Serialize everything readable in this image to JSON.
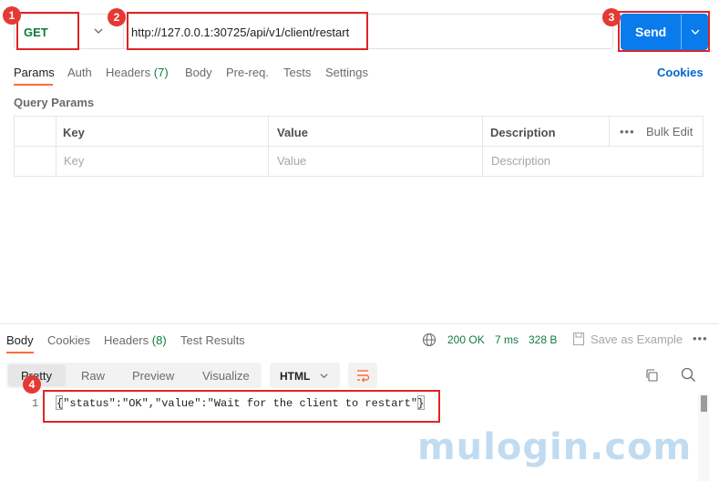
{
  "request": {
    "method": "GET",
    "url": "http://127.0.0.1:30725/api/v1/client/restart",
    "send_label": "Send"
  },
  "request_tabs": [
    {
      "label": "Params"
    },
    {
      "label": "Auth"
    },
    {
      "label": "Headers",
      "count": "(7)"
    },
    {
      "label": "Body"
    },
    {
      "label": "Pre-req."
    },
    {
      "label": "Tests"
    },
    {
      "label": "Settings"
    }
  ],
  "cookies_label": "Cookies",
  "query_params": {
    "title": "Query Params",
    "columns": [
      "Key",
      "Value",
      "Description"
    ],
    "bulk_edit": "Bulk Edit",
    "placeholders": [
      "Key",
      "Value",
      "Description"
    ]
  },
  "response": {
    "tabs": [
      {
        "label": "Body"
      },
      {
        "label": "Cookies"
      },
      {
        "label": "Headers",
        "count": "(8)"
      },
      {
        "label": "Test Results"
      }
    ],
    "status": "200 OK",
    "time": "7 ms",
    "size": "328 B",
    "save_example": "Save as Example",
    "views": [
      "Pretty",
      "Raw",
      "Preview",
      "Visualize"
    ],
    "format": "HTML",
    "line_number": "1",
    "body": "{\"status\":\"OK\",\"value\":\"Wait for the client to restart\"}"
  },
  "callouts": [
    "1",
    "2",
    "3",
    "4"
  ],
  "watermark": "mulogin.com",
  "colors": {
    "accent": "#ff6c37",
    "send_button": "#097bed",
    "method_get": "#0f7b3c",
    "status_ok": "#0f7b3c",
    "callout_red": "#e02525",
    "link": "#0265d2"
  }
}
